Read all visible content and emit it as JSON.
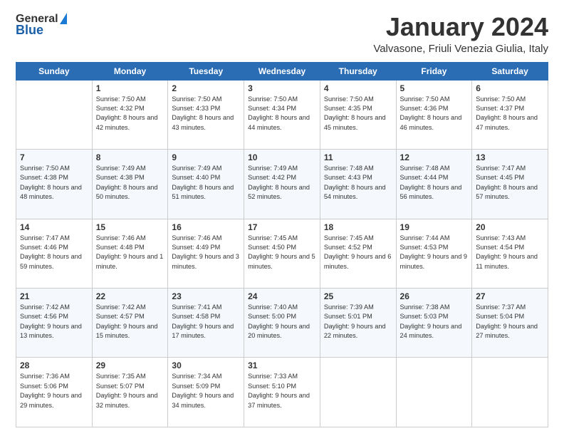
{
  "header": {
    "logo_general": "General",
    "logo_blue": "Blue",
    "month_title": "January 2024",
    "location": "Valvasone, Friuli Venezia Giulia, Italy"
  },
  "days_of_week": [
    "Sunday",
    "Monday",
    "Tuesday",
    "Wednesday",
    "Thursday",
    "Friday",
    "Saturday"
  ],
  "weeks": [
    [
      {
        "day": "",
        "sunrise": "",
        "sunset": "",
        "daylight": ""
      },
      {
        "day": "1",
        "sunrise": "Sunrise: 7:50 AM",
        "sunset": "Sunset: 4:32 PM",
        "daylight": "Daylight: 8 hours and 42 minutes."
      },
      {
        "day": "2",
        "sunrise": "Sunrise: 7:50 AM",
        "sunset": "Sunset: 4:33 PM",
        "daylight": "Daylight: 8 hours and 43 minutes."
      },
      {
        "day": "3",
        "sunrise": "Sunrise: 7:50 AM",
        "sunset": "Sunset: 4:34 PM",
        "daylight": "Daylight: 8 hours and 44 minutes."
      },
      {
        "day": "4",
        "sunrise": "Sunrise: 7:50 AM",
        "sunset": "Sunset: 4:35 PM",
        "daylight": "Daylight: 8 hours and 45 minutes."
      },
      {
        "day": "5",
        "sunrise": "Sunrise: 7:50 AM",
        "sunset": "Sunset: 4:36 PM",
        "daylight": "Daylight: 8 hours and 46 minutes."
      },
      {
        "day": "6",
        "sunrise": "Sunrise: 7:50 AM",
        "sunset": "Sunset: 4:37 PM",
        "daylight": "Daylight: 8 hours and 47 minutes."
      }
    ],
    [
      {
        "day": "7",
        "sunrise": "",
        "sunset": "",
        "daylight": "Daylight: 8 hours and 48 minutes."
      },
      {
        "day": "8",
        "sunrise": "Sunrise: 7:49 AM",
        "sunset": "Sunset: 4:38 PM",
        "daylight": "Daylight: 8 hours and 50 minutes."
      },
      {
        "day": "9",
        "sunrise": "Sunrise: 7:49 AM",
        "sunset": "Sunset: 4:40 PM",
        "daylight": "Daylight: 8 hours and 51 minutes."
      },
      {
        "day": "10",
        "sunrise": "Sunrise: 7:49 AM",
        "sunset": "Sunset: 4:42 PM",
        "daylight": "Daylight: 8 hours and 52 minutes."
      },
      {
        "day": "11",
        "sunrise": "Sunrise: 7:48 AM",
        "sunset": "Sunset: 4:43 PM",
        "daylight": "Daylight: 8 hours and 54 minutes."
      },
      {
        "day": "12",
        "sunrise": "Sunrise: 7:48 AM",
        "sunset": "Sunset: 4:44 PM",
        "daylight": "Daylight: 8 hours and 56 minutes."
      },
      {
        "day": "13",
        "sunrise": "Sunrise: 7:47 AM",
        "sunset": "Sunset: 4:45 PM",
        "daylight": "Daylight: 8 hours and 57 minutes."
      }
    ],
    [
      {
        "day": "14",
        "sunrise": "",
        "sunset": "",
        "daylight": "Daylight: 8 hours and 59 minutes."
      },
      {
        "day": "15",
        "sunrise": "Sunrise: 7:46 AM",
        "sunset": "Sunset: 4:48 PM",
        "daylight": "Daylight: 9 hours and 1 minute."
      },
      {
        "day": "16",
        "sunrise": "Sunrise: 7:46 AM",
        "sunset": "Sunset: 4:49 PM",
        "daylight": "Daylight: 9 hours and 3 minutes."
      },
      {
        "day": "17",
        "sunrise": "Sunrise: 7:45 AM",
        "sunset": "Sunset: 4:50 PM",
        "daylight": "Daylight: 9 hours and 5 minutes."
      },
      {
        "day": "18",
        "sunrise": "Sunrise: 7:45 AM",
        "sunset": "Sunset: 4:52 PM",
        "daylight": "Daylight: 9 hours and 6 minutes."
      },
      {
        "day": "19",
        "sunrise": "Sunrise: 7:44 AM",
        "sunset": "Sunset: 4:53 PM",
        "daylight": "Daylight: 9 hours and 9 minutes."
      },
      {
        "day": "20",
        "sunrise": "Sunrise: 7:43 AM",
        "sunset": "Sunset: 4:54 PM",
        "daylight": "Daylight: 9 hours and 11 minutes."
      }
    ],
    [
      {
        "day": "21",
        "sunrise": "",
        "sunset": "",
        "daylight": "Daylight: 9 hours and 13 minutes."
      },
      {
        "day": "22",
        "sunrise": "Sunrise: 7:42 AM",
        "sunset": "Sunset: 4:57 PM",
        "daylight": "Daylight: 9 hours and 15 minutes."
      },
      {
        "day": "23",
        "sunrise": "Sunrise: 7:41 AM",
        "sunset": "Sunset: 4:58 PM",
        "daylight": "Daylight: 9 hours and 17 minutes."
      },
      {
        "day": "24",
        "sunrise": "Sunrise: 7:40 AM",
        "sunset": "Sunset: 5:00 PM",
        "daylight": "Daylight: 9 hours and 20 minutes."
      },
      {
        "day": "25",
        "sunrise": "Sunrise: 7:39 AM",
        "sunset": "Sunset: 5:01 PM",
        "daylight": "Daylight: 9 hours and 22 minutes."
      },
      {
        "day": "26",
        "sunrise": "Sunrise: 7:38 AM",
        "sunset": "Sunset: 5:03 PM",
        "daylight": "Daylight: 9 hours and 24 minutes."
      },
      {
        "day": "27",
        "sunrise": "Sunrise: 7:37 AM",
        "sunset": "Sunset: 5:04 PM",
        "daylight": "Daylight: 9 hours and 27 minutes."
      }
    ],
    [
      {
        "day": "28",
        "sunrise": "Sunrise: 7:36 AM",
        "sunset": "Sunset: 5:06 PM",
        "daylight": "Daylight: 9 hours and 29 minutes."
      },
      {
        "day": "29",
        "sunrise": "Sunrise: 7:35 AM",
        "sunset": "Sunset: 5:07 PM",
        "daylight": "Daylight: 9 hours and 32 minutes."
      },
      {
        "day": "30",
        "sunrise": "Sunrise: 7:34 AM",
        "sunset": "Sunset: 5:09 PM",
        "daylight": "Daylight: 9 hours and 34 minutes."
      },
      {
        "day": "31",
        "sunrise": "Sunrise: 7:33 AM",
        "sunset": "Sunset: 5:10 PM",
        "daylight": "Daylight: 9 hours and 37 minutes."
      },
      {
        "day": "",
        "sunrise": "",
        "sunset": "",
        "daylight": ""
      },
      {
        "day": "",
        "sunrise": "",
        "sunset": "",
        "daylight": ""
      },
      {
        "day": "",
        "sunrise": "",
        "sunset": "",
        "daylight": ""
      }
    ]
  ],
  "week7_sun": {
    "sunrise": "Sunrise: 7:50 AM",
    "sunset": "Sunset: 4:38 PM"
  },
  "week14_sun": {
    "sunrise": "Sunrise: 7:47 AM",
    "sunset": "Sunset: 4:46 PM"
  },
  "week21_sun": {
    "sunrise": "Sunrise: 7:42 AM",
    "sunset": "Sunset: 4:56 PM"
  }
}
